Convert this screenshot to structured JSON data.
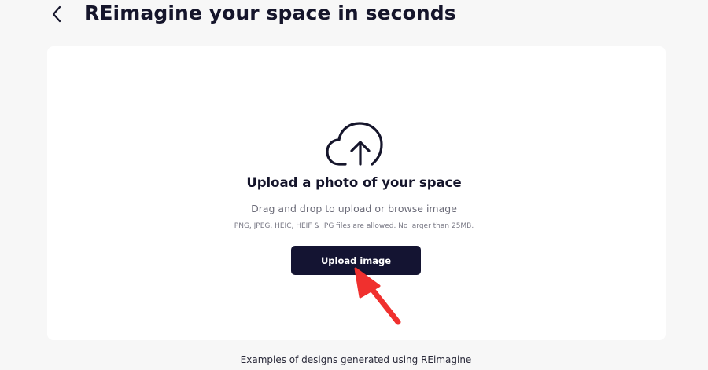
{
  "header": {
    "title": "REimagine your space in seconds",
    "back_icon": "chevron-left-icon"
  },
  "upload": {
    "icon": "cloud-upload-icon",
    "heading": "Upload a photo of your space",
    "instructions": "Drag and drop to upload or browse image",
    "file_info": "PNG, JPEG, HEIC, HEIF & JPG files are allowed. No larger than 25MB.",
    "button_label": "Upload image"
  },
  "annotation": {
    "icon": "red-arrow-pointer",
    "color": "#f0302e"
  },
  "footer": {
    "examples_text": "Examples of designs generated using REimagine"
  },
  "colors": {
    "background": "#f7f7f7",
    "card": "#ffffff",
    "primary_button": "#141432",
    "text_dark": "#15152b"
  }
}
